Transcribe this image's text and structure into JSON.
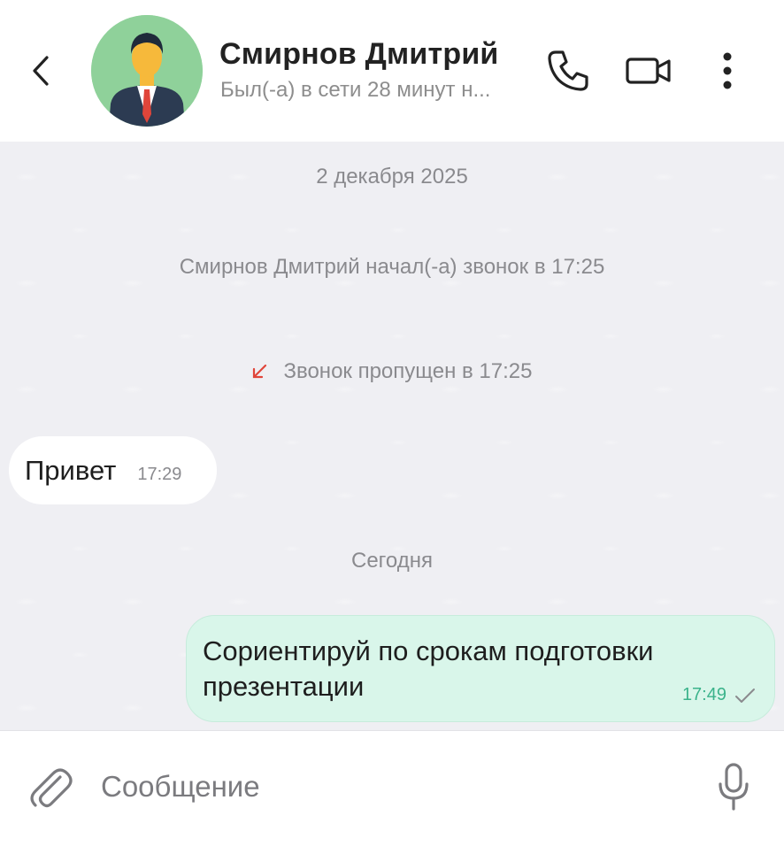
{
  "header": {
    "contact_name": "Смирнов Дмитрий",
    "status": "Был(-а) в сети 28 минут н...",
    "icons": [
      "chevron-left-icon",
      "avatar",
      "phone-icon",
      "video-camera-icon",
      "more-vertical-icon"
    ]
  },
  "chat": {
    "date_separator": "2 декабря 2025",
    "call_started": "Смирнов Дмитрий начал(-а) звонок в 17:25",
    "missed_call": "Звонок пропущен в 17:25",
    "incoming_message": {
      "text": "Привет",
      "time": "17:29"
    },
    "today_separator": "Сегодня",
    "outgoing_message": {
      "text": "Сориентируй по срокам подготовки презентации",
      "time": "17:49",
      "status_icon": "check-icon"
    }
  },
  "input": {
    "placeholder": "Сообщение",
    "value": "",
    "icons": [
      "paperclip-icon",
      "microphone-icon"
    ]
  },
  "colors": {
    "chat_background": "#efeff3",
    "outgoing_bubble": "#d9f6ea",
    "outgoing_time": "#3bb38b",
    "missed_call_arrow": "#e0453a",
    "avatar_background": "#8fd19a"
  }
}
